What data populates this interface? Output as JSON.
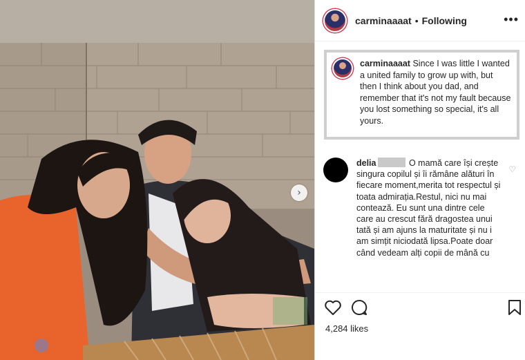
{
  "post": {
    "username": "carminaaaat",
    "follow_state": "Following",
    "more_icon": "•••",
    "carousel_next_icon": "›"
  },
  "caption": {
    "username": "carminaaaat",
    "text": "Since I was little I wanted a united family to grow up with, but then I think about you dad, and remember that it's not my fault because you lost something so special, it's all yours."
  },
  "comment": {
    "username": "delia",
    "text": "O mamă care își crește singura copilul și îi rămâne alături în fiecare moment,merita tot respectul și toata admirația.Restul, nici nu mai contează. Eu sunt una dintre cele care au crescut fără dragostea unui tată și am ajuns la maturitate și nu i am simțit niciodată lipsa.Poate doar când vedeam alți copii de mână cu"
  },
  "likes": "4,284 likes",
  "icons": {
    "more": "more-options-icon",
    "heart": "heart-icon",
    "comment": "comment-icon",
    "bookmark": "bookmark-icon",
    "carousel": "chevron-right-icon"
  },
  "colors": {
    "text": "#262626",
    "border": "#dbdbdb",
    "story_ring": "#d0405a",
    "caption_frame": "#cfcfcf"
  }
}
